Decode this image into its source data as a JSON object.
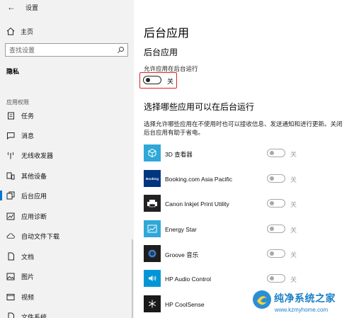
{
  "window": {
    "title": "设置"
  },
  "sidebar": {
    "home_label": "主页",
    "search_placeholder": "查找设置",
    "section_title": "隐私",
    "group_title": "应用权限",
    "items": [
      {
        "label": "任务",
        "icon": "task-icon"
      },
      {
        "label": "消息",
        "icon": "message-icon"
      },
      {
        "label": "无线收发器",
        "icon": "radio-icon"
      },
      {
        "label": "其他设备",
        "icon": "devices-icon"
      },
      {
        "label": "后台应用",
        "icon": "background-apps-icon",
        "active": true
      },
      {
        "label": "应用诊断",
        "icon": "diagnostics-icon"
      },
      {
        "label": "自动文件下载",
        "icon": "cloud-icon"
      },
      {
        "label": "文档",
        "icon": "document-icon"
      },
      {
        "label": "图片",
        "icon": "picture-icon"
      },
      {
        "label": "视频",
        "icon": "video-icon"
      },
      {
        "label": "文件系统",
        "icon": "file-system-icon"
      }
    ]
  },
  "main": {
    "page_title": "后台应用",
    "sub_title": "后台应用",
    "allow_label": "允许应用在后台运行",
    "allow_state": "关",
    "choose_title": "选择哪些应用可以在后台运行",
    "description": "选择允许哪些应用在不使用时也可以接收信息、发送通知和进行更新。关闭后台应用有助于省电。",
    "apps": [
      {
        "name": "3D 查看器",
        "state": "关",
        "tile_color": "#2fa8d8",
        "icon": "cube-icon"
      },
      {
        "name": "Booking.com Asia Pacific",
        "state": "关",
        "tile_color": "#003580",
        "icon": "booking-logo-icon",
        "tile_text": "Booking"
      },
      {
        "name": "Canon Inkjet Print Utility",
        "state": "关",
        "tile_color": "#222222",
        "icon": "printer-icon"
      },
      {
        "name": "Energy Star",
        "state": "关",
        "tile_color": "#2fa8d8",
        "icon": "energy-chart-icon"
      },
      {
        "name": "Groove 音乐",
        "state": "关",
        "tile_color": "#1e1e1e",
        "icon": "music-disc-icon"
      },
      {
        "name": "HP Audio Control",
        "state": "关",
        "tile_color": "#0096d6",
        "icon": "speaker-icon"
      },
      {
        "name": "HP CoolSense",
        "state": "关",
        "tile_color": "#1a1a1a",
        "icon": "snowflake-icon"
      }
    ]
  },
  "watermark": {
    "title": "纯净系统之家",
    "url": "www.kzmyhome.com"
  },
  "colors": {
    "accent": "#0078d7",
    "highlight_border": "#e02020",
    "sidebar_bg": "#f2f2f2"
  }
}
